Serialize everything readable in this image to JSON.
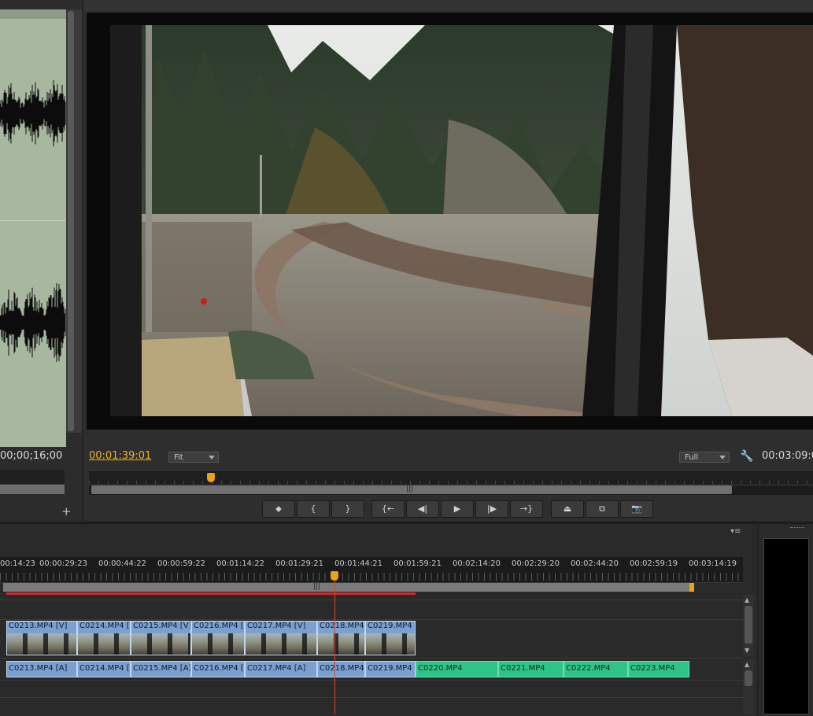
{
  "source_monitor": {
    "timecode": "00;00;16;00"
  },
  "program_monitor": {
    "current_timecode": "00:01:39:01",
    "zoom_dropdown": "Fit",
    "resolution_dropdown": "Full",
    "duration_timecode": "00:03:09:0"
  },
  "transport": {
    "buttons": [
      {
        "name": "add-marker-button",
        "icon": "marker-icon",
        "glyph": "⬥"
      },
      {
        "name": "mark-in-button",
        "icon": "mark-in-icon",
        "glyph": "{"
      },
      {
        "name": "mark-out-button",
        "icon": "mark-out-icon",
        "glyph": "}"
      },
      {
        "name": "go-to-in-button",
        "icon": "go-to-in-icon",
        "glyph": "{←"
      },
      {
        "name": "step-back-button",
        "icon": "step-back-icon",
        "glyph": "◀|"
      },
      {
        "name": "play-button",
        "icon": "play-icon",
        "glyph": "▶"
      },
      {
        "name": "step-forward-button",
        "icon": "step-forward-icon",
        "glyph": "|▶"
      },
      {
        "name": "go-to-out-button",
        "icon": "go-to-out-icon",
        "glyph": "→}"
      },
      {
        "name": "lift-button",
        "icon": "lift-icon",
        "glyph": "⏏"
      },
      {
        "name": "extract-button",
        "icon": "extract-icon",
        "glyph": "⧉"
      },
      {
        "name": "export-frame-button",
        "icon": "camera-icon",
        "glyph": "📷"
      }
    ]
  },
  "timeline": {
    "ruler_labels": [
      "00:14:23",
      "00:00:29:23",
      "00:00:44:22",
      "00:00:59:22",
      "00:01:14:22",
      "00:01:29:21",
      "00:01:44:21",
      "00:01:59:21",
      "00:02:14:20",
      "00:02:29:20",
      "00:02:44:20",
      "00:02:59:19",
      "00:03:14:19"
    ],
    "video_clips": [
      "C0213.MP4 [V]",
      "C0214.MP4 [",
      "C0215.MP4 [V]",
      "C0216.MP4 [",
      "C0217.MP4 [V]",
      "C0218.MP4",
      "C0219.MP4"
    ],
    "audio_clips": [
      "C0213.MP4 [A]",
      "C0214.MP4 [",
      "C0215.MP4 [A]",
      "C0216.MP4 [",
      "C0217.MP4 [A]",
      "C0218.MP4",
      "C0219.MP4"
    ],
    "green_clips": [
      "C0220.MP4",
      "C0221.MP4",
      "C0222.MP4",
      "C0223.MP4"
    ],
    "menu_icon": "panel-menu-icon"
  },
  "colors": {
    "timecode_accent": "#f0b323",
    "clip_blue": "#7aa0cf",
    "clip_green": "#2fc487",
    "playhead": "#d9452b"
  }
}
